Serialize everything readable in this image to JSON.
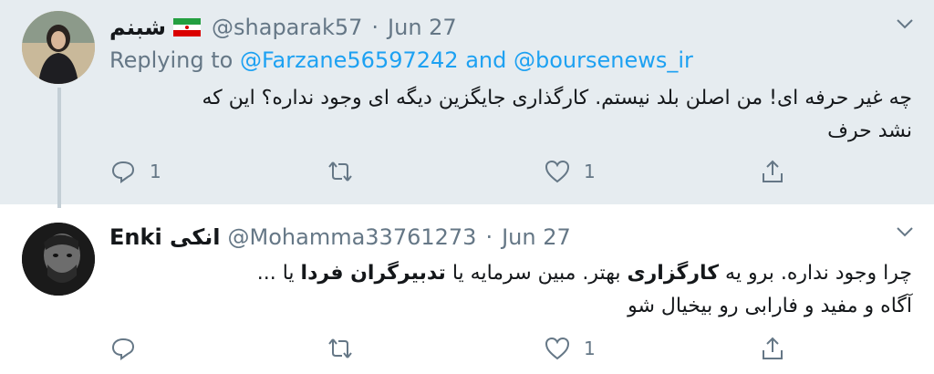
{
  "tweets": [
    {
      "display_name": "شبنم",
      "handle": "@shaparak57",
      "date": "Jun 27",
      "replying_prefix": "Replying to",
      "replying_user1": "@Farzane56597242",
      "replying_and": "and",
      "replying_user2": "@boursenews_ir",
      "text_line1": "چه غیر حرفه ای! من اصلن بلد نیستم. کارگذاری جایگزین دیگه ای وجود نداره؟ این که",
      "text_line2": "نشد حرف",
      "reply_count": "1",
      "retweet_count": "",
      "like_count": "1"
    },
    {
      "display_name_latin": "Enki",
      "display_name_fa": "انکی",
      "handle": "@Mohamma33761273",
      "date": "Jun 27",
      "text_l1_a": "چرا وجود نداره. برو یه",
      "text_l1_b": "کارگزاری",
      "text_l1_c": "بهتر. مبین سرمایه یا",
      "text_l1_d": "تدبیرگران فردا",
      "text_l1_e": "یا ...",
      "text_line2": "آگاه و مفید و فارابی رو بیخیال شو",
      "reply_count": "",
      "retweet_count": "",
      "like_count": "1"
    }
  ],
  "colors": {
    "accent": "#1da1f2",
    "muted": "#657786",
    "thread_bg": "#e6ecf0"
  },
  "icons": [
    "reply-icon",
    "retweet-icon",
    "like-icon",
    "share-icon",
    "chevron-down-icon",
    "iran-flag-icon"
  ]
}
